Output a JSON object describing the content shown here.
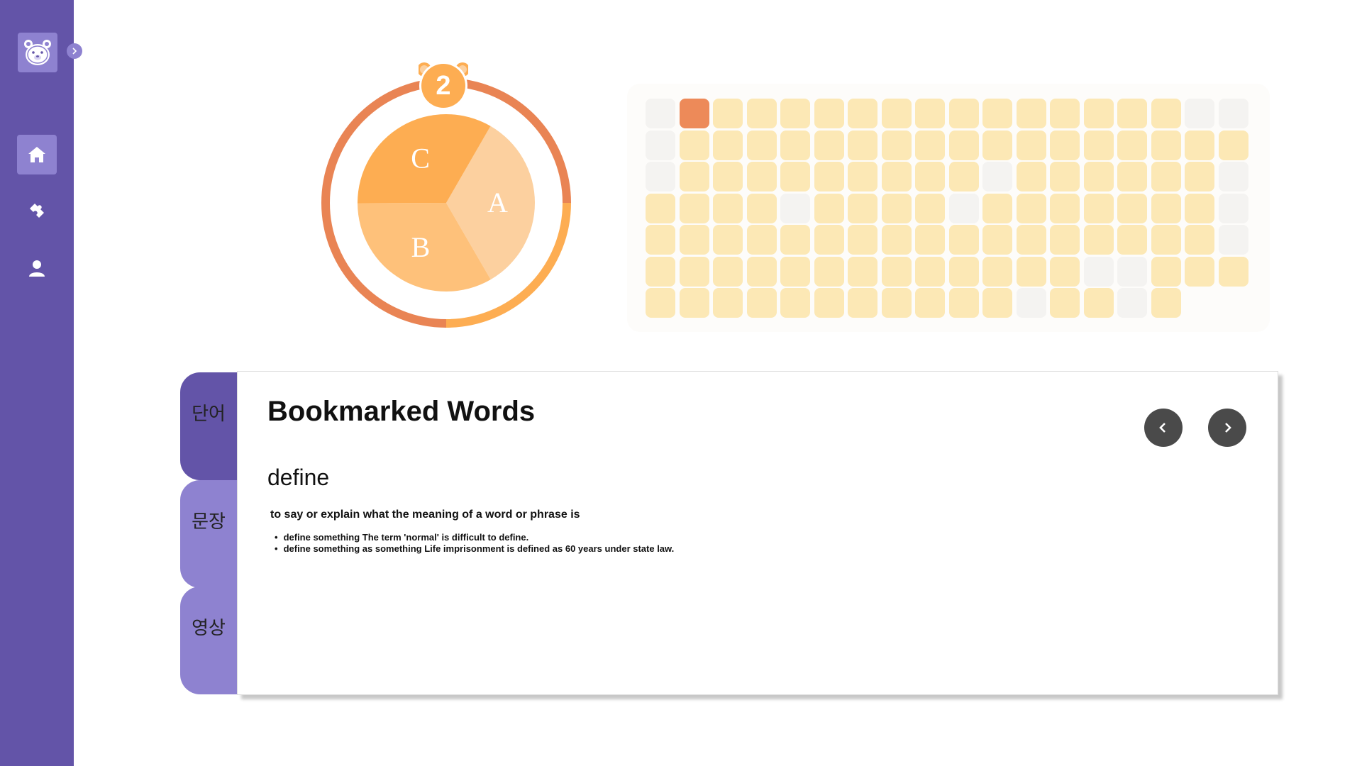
{
  "sidebar": {
    "logo_icon": "bear-icon",
    "collapse_icon": "chevron-right-icon",
    "items": [
      {
        "icon": "home-icon",
        "active": true
      },
      {
        "icon": "puzzle-icon",
        "active": false
      },
      {
        "icon": "user-icon",
        "active": false
      }
    ]
  },
  "donut": {
    "level": "2",
    "segments": [
      {
        "label": "A",
        "value": 33.3,
        "color": "#fcd09f"
      },
      {
        "label": "B",
        "value": 33.3,
        "color": "#fec17a"
      },
      {
        "label": "C",
        "value": 33.4,
        "color": "#fdad52"
      }
    ],
    "progress_fraction": 0.75,
    "ring_colors": {
      "progress": "#e98454",
      "remaining": "#fdad52"
    }
  },
  "heatmap": {
    "columns": 18,
    "rows": 7,
    "colors": {
      "empty": "#f4f3f1",
      "filled": "#fce8b5",
      "highlight": "#ed8a59"
    },
    "levels": [
      "EHFFFFFFFFFFFFFFEE",
      "EFFFFFFFFFFFFFFFFF",
      "EFFFFFFFFFEFFFFFFE",
      "FFFFEFFFFEFFFFFFFE",
      "FFFFFFFFFFFFFFFFFE",
      "FFFFFFFFFFFFFEEFFF",
      "FFFFFFFFFFFEFFEF  "
    ]
  },
  "tabs": [
    {
      "label": "단어",
      "active": true
    },
    {
      "label": "문장",
      "active": false
    },
    {
      "label": "영상",
      "active": false
    }
  ],
  "panel": {
    "title": "Bookmarked Words",
    "word": "define",
    "definition": "to say or explain what the meaning of a word or phrase is",
    "examples": [
      "define something The term 'normal' is difficult to define.",
      "define something as something Life imprisonment is defined as 60 years under state law."
    ],
    "prev_icon": "chevron-left-icon",
    "next_icon": "chevron-right-icon"
  }
}
